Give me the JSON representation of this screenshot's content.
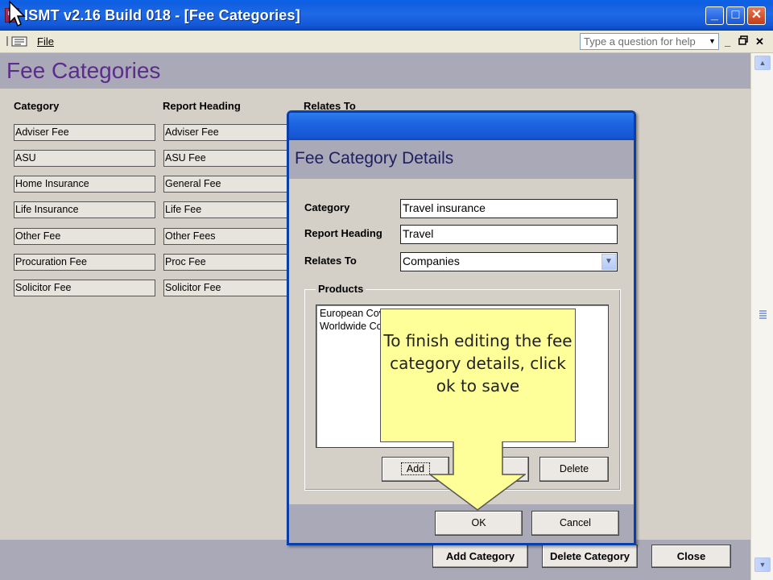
{
  "window": {
    "title": "ISMT v2.16 Build 018 - [Fee Categories]",
    "controls": {
      "minimize": "_",
      "maximize": "□",
      "close": "✕"
    }
  },
  "menubar": {
    "file_label": "File",
    "help_placeholder": "Type a question for help",
    "mdi_minimize": "_",
    "mdi_restore": "🗗",
    "mdi_close": "✕"
  },
  "form": {
    "title": "Fee Categories",
    "columns": {
      "category": "Category",
      "report_heading": "Report Heading",
      "relates_to": "Relates To"
    },
    "rows": [
      {
        "category": "Adviser Fee",
        "report_heading": "Adviser Fee"
      },
      {
        "category": "ASU",
        "report_heading": "ASU Fee"
      },
      {
        "category": "Home Insurance",
        "report_heading": "General Fee"
      },
      {
        "category": "Life Insurance",
        "report_heading": "Life Fee"
      },
      {
        "category": "Other Fee",
        "report_heading": "Other Fees"
      },
      {
        "category": "Procuration Fee",
        "report_heading": "Proc Fee"
      },
      {
        "category": "Solicitor Fee",
        "report_heading": "Solicitor Fee"
      }
    ],
    "buttons": {
      "add": "Add Category",
      "delete": "Delete Category",
      "close": "Close"
    }
  },
  "dialog": {
    "title": "Fee Category Details",
    "fields": {
      "category_label": "Category",
      "category_value": "Travel insurance",
      "report_heading_label": "Report Heading",
      "report_heading_value": "Travel",
      "relates_to_label": "Relates To",
      "relates_to_value": "Companies"
    },
    "products": {
      "label": "Products",
      "items": [
        "European Cov",
        "Worldwide Co"
      ],
      "add_label": "Add",
      "delete_label": "Delete"
    },
    "ok_label": "OK",
    "cancel_label": "Cancel"
  },
  "callout": {
    "text": "To finish editing the fee category details, click ok to save",
    "color": "#ffff99"
  },
  "colors": {
    "titlebar": "#1e69e6",
    "header_band": "#a9a9b8",
    "form_title": "#5b2d8a"
  }
}
